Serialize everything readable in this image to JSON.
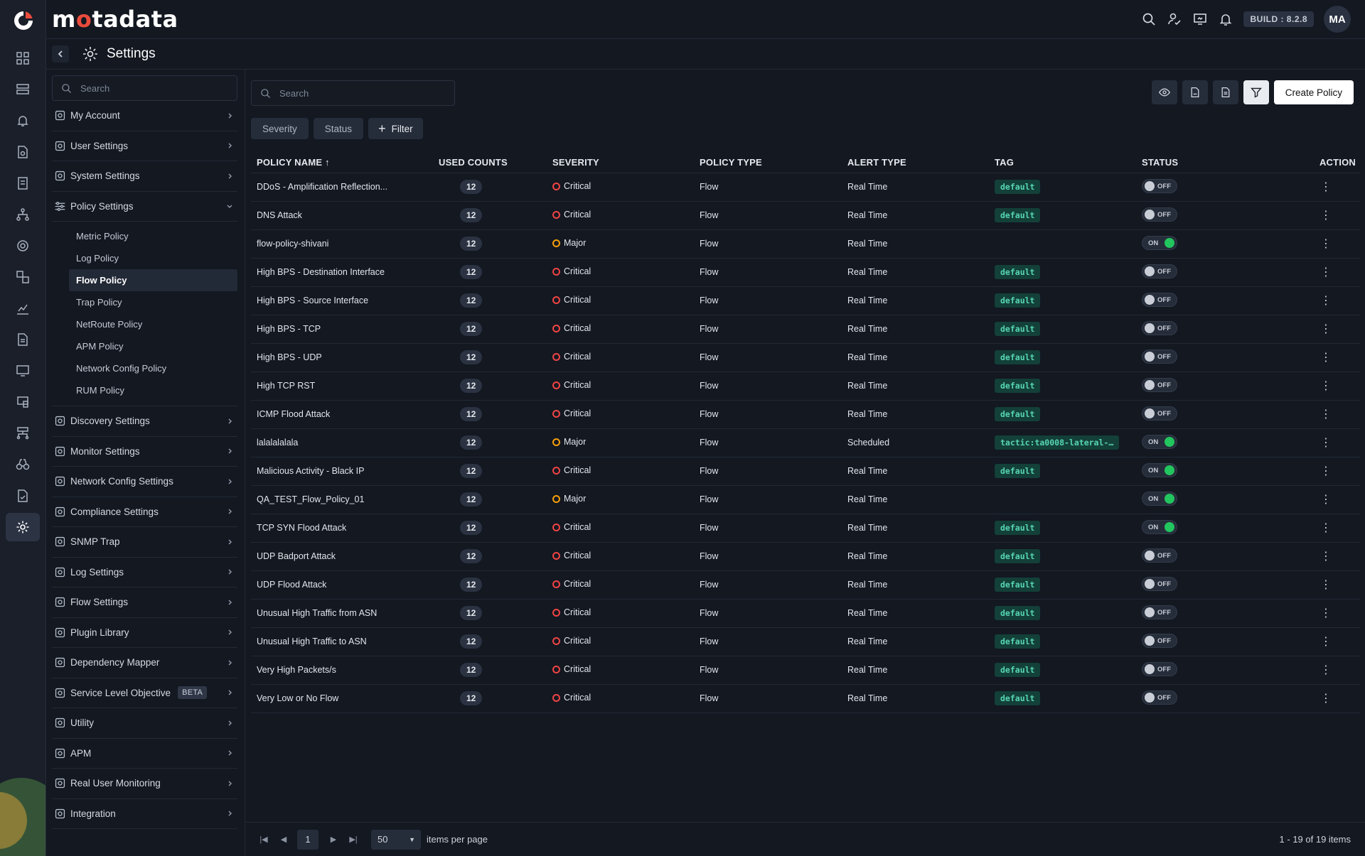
{
  "brand": {
    "name_start": "m",
    "name_dot": "o",
    "name_end": "tadata"
  },
  "topbar": {
    "build": "BUILD : 8.2.8",
    "avatar": "MA"
  },
  "page": {
    "title": "Settings"
  },
  "nav": {
    "search_placeholder": "Search",
    "groups_top": [
      {
        "label": "My Account",
        "icon": "user-card-icon"
      },
      {
        "label": "User Settings",
        "icon": "users-gear-icon"
      },
      {
        "label": "System Settings",
        "icon": "monitor-gear-icon"
      }
    ],
    "policy_group": {
      "label": "Policy Settings",
      "icon": "sliders-icon"
    },
    "policy_items": [
      "Metric Policy",
      "Log Policy",
      "Flow Policy",
      "Trap Policy",
      "NetRoute Policy",
      "APM Policy",
      "Network Config Policy",
      "RUM Policy"
    ],
    "active_policy": "Flow Policy",
    "groups_bottom": [
      {
        "label": "Discovery Settings",
        "icon": "discovery-icon"
      },
      {
        "label": "Monitor Settings",
        "icon": "monitor-icon"
      },
      {
        "label": "Network Config Settings",
        "icon": "network-config-icon"
      },
      {
        "label": "Compliance Settings",
        "icon": "compliance-icon"
      },
      {
        "label": "SNMP Trap",
        "icon": "binoculars-icon"
      },
      {
        "label": "Log Settings",
        "icon": "log-file-icon"
      },
      {
        "label": "Flow Settings",
        "icon": "flow-icon"
      },
      {
        "label": "Plugin Library",
        "icon": "plugin-icon"
      },
      {
        "label": "Dependency Mapper",
        "icon": "dependency-icon"
      },
      {
        "label": "Service Level Objective",
        "icon": "slo-icon",
        "badge": "BETA"
      },
      {
        "label": "Utility",
        "icon": "utility-gear-icon"
      },
      {
        "label": "APM",
        "icon": "apm-icon"
      },
      {
        "label": "Real User Monitoring",
        "icon": "rum-icon"
      },
      {
        "label": "Integration",
        "icon": "integration-plug-icon"
      }
    ]
  },
  "toolbar": {
    "search_placeholder": "Search",
    "create_label": "Create Policy",
    "chips": [
      "Severity",
      "Status"
    ],
    "filter_label": "Filter"
  },
  "table": {
    "columns": [
      "POLICY NAME ↑",
      "USED COUNTS",
      "SEVERITY",
      "POLICY TYPE",
      "ALERT TYPE",
      "TAG",
      "STATUS",
      "ACTION"
    ],
    "rows": [
      {
        "name": "DDoS - Amplification Reflection...",
        "count": "12",
        "severity": "Critical",
        "type": "Flow",
        "alert": "Real Time",
        "tag": "default",
        "status": "OFF"
      },
      {
        "name": "DNS Attack",
        "count": "12",
        "severity": "Critical",
        "type": "Flow",
        "alert": "Real Time",
        "tag": "default",
        "status": "OFF"
      },
      {
        "name": "flow-policy-shivani",
        "count": "12",
        "severity": "Major",
        "type": "Flow",
        "alert": "Real Time",
        "tag": "",
        "status": "ON"
      },
      {
        "name": "High BPS - Destination Interface",
        "count": "12",
        "severity": "Critical",
        "type": "Flow",
        "alert": "Real Time",
        "tag": "default",
        "status": "OFF"
      },
      {
        "name": "High BPS - Source Interface",
        "count": "12",
        "severity": "Critical",
        "type": "Flow",
        "alert": "Real Time",
        "tag": "default",
        "status": "OFF"
      },
      {
        "name": "High BPS - TCP",
        "count": "12",
        "severity": "Critical",
        "type": "Flow",
        "alert": "Real Time",
        "tag": "default",
        "status": "OFF"
      },
      {
        "name": "High BPS - UDP",
        "count": "12",
        "severity": "Critical",
        "type": "Flow",
        "alert": "Real Time",
        "tag": "default",
        "status": "OFF"
      },
      {
        "name": "High TCP RST",
        "count": "12",
        "severity": "Critical",
        "type": "Flow",
        "alert": "Real Time",
        "tag": "default",
        "status": "OFF"
      },
      {
        "name": "ICMP Flood Attack",
        "count": "12",
        "severity": "Critical",
        "type": "Flow",
        "alert": "Real Time",
        "tag": "default",
        "status": "OFF"
      },
      {
        "name": "lalalalalala",
        "count": "12",
        "severity": "Major",
        "type": "Flow",
        "alert": "Scheduled",
        "tag": "tactic:ta0008-lateral-…",
        "status": "ON"
      },
      {
        "name": "Malicious Activity - Black IP",
        "count": "12",
        "severity": "Critical",
        "type": "Flow",
        "alert": "Real Time",
        "tag": "default",
        "status": "ON"
      },
      {
        "name": "QA_TEST_Flow_Policy_01",
        "count": "12",
        "severity": "Major",
        "type": "Flow",
        "alert": "Real Time",
        "tag": "",
        "status": "ON"
      },
      {
        "name": "TCP SYN Flood Attack",
        "count": "12",
        "severity": "Critical",
        "type": "Flow",
        "alert": "Real Time",
        "tag": "default",
        "status": "ON"
      },
      {
        "name": "UDP Badport Attack",
        "count": "12",
        "severity": "Critical",
        "type": "Flow",
        "alert": "Real Time",
        "tag": "default",
        "status": "OFF"
      },
      {
        "name": "UDP Flood Attack",
        "count": "12",
        "severity": "Critical",
        "type": "Flow",
        "alert": "Real Time",
        "tag": "default",
        "status": "OFF"
      },
      {
        "name": "Unusual High Traffic from ASN",
        "count": "12",
        "severity": "Critical",
        "type": "Flow",
        "alert": "Real Time",
        "tag": "default",
        "status": "OFF"
      },
      {
        "name": "Unusual High Traffic to ASN",
        "count": "12",
        "severity": "Critical",
        "type": "Flow",
        "alert": "Real Time",
        "tag": "default",
        "status": "OFF"
      },
      {
        "name": "Very High Packets/s",
        "count": "12",
        "severity": "Critical",
        "type": "Flow",
        "alert": "Real Time",
        "tag": "default",
        "status": "OFF"
      },
      {
        "name": "Very Low or No Flow",
        "count": "12",
        "severity": "Critical",
        "type": "Flow",
        "alert": "Real Time",
        "tag": "default",
        "status": "OFF"
      }
    ]
  },
  "colors": {
    "critical": "#ef4444",
    "major": "#f59e0b",
    "tag_bg": "#134038",
    "tag_fg": "#57d6b4",
    "on": "#22c55e"
  },
  "pager": {
    "page": "1",
    "size": "50",
    "items_per_page": "items per page",
    "total": "1 - 19 of 19 items"
  }
}
